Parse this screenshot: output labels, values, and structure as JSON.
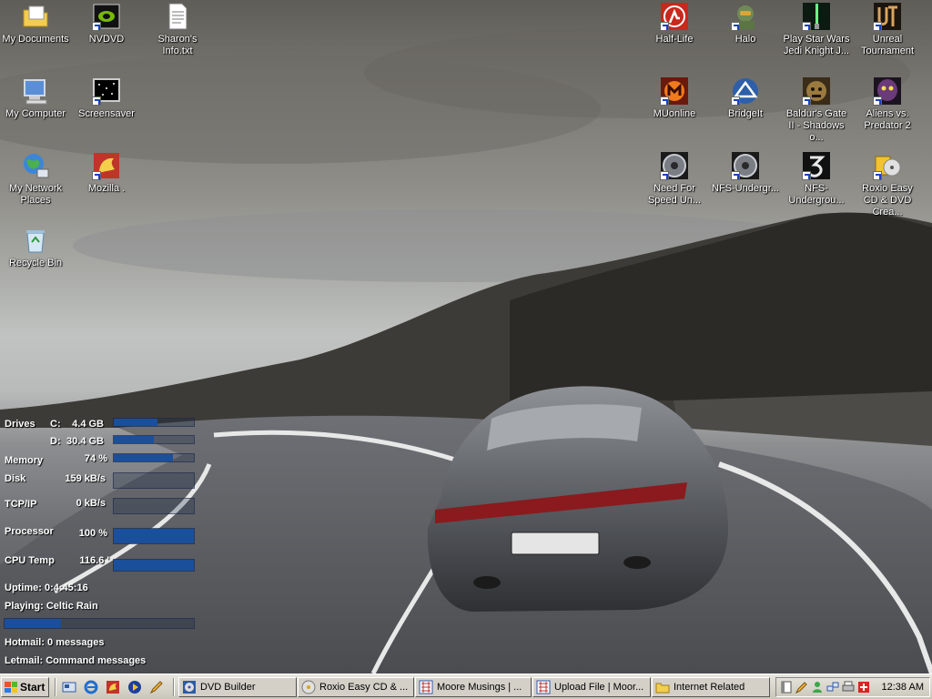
{
  "desktop": {
    "left_icons": [
      {
        "name": "my-documents-icon",
        "label": "My Documents"
      },
      {
        "name": "nvdvd-icon",
        "label": "NVDVD"
      },
      {
        "name": "text-file-icon",
        "label": "Sharon's Info.txt"
      },
      {
        "name": "my-computer-icon",
        "label": "My Computer"
      },
      {
        "name": "screensaver-icon",
        "label": "Screensaver"
      },
      {
        "name": "network-places-icon",
        "label": "My Network Places"
      },
      {
        "name": "mozilla-icon",
        "label": "Mozilla ."
      },
      {
        "name": "recycle-bin-icon",
        "label": "Recycle Bin"
      }
    ],
    "right_icons": [
      {
        "name": "half-life-icon",
        "label": "Half-Life"
      },
      {
        "name": "halo-icon",
        "label": "Halo"
      },
      {
        "name": "jedi-knight-icon",
        "label": "Play Star Wars Jedi Knight J..."
      },
      {
        "name": "unreal-tournament-icon",
        "label": "Unreal Tournament"
      },
      {
        "name": "muonline-icon",
        "label": "MUonline"
      },
      {
        "name": "bridgeit-icon",
        "label": "BridgeIt"
      },
      {
        "name": "baldurs-gate-icon",
        "label": "Baldur's Gate II - Shadows o..."
      },
      {
        "name": "aliens-vs-predator-icon",
        "label": "Aliens vs. Predator 2"
      },
      {
        "name": "need-for-speed-icon",
        "label": "Need For Speed Un..."
      },
      {
        "name": "nfs-underground-icon",
        "label": "NFS-Undergr..."
      },
      {
        "name": "nfs-underground-2-icon",
        "label": "NFS-Undergrou..."
      },
      {
        "name": "roxio-icon",
        "label": "Roxio Easy CD & DVD Crea..."
      }
    ]
  },
  "monitor": {
    "drives_label": "Drives",
    "drive_c_label": "C:",
    "drive_c_value": "4.4 GB",
    "drive_c_fill": 0.55,
    "drive_d_label": "D:",
    "drive_d_value": "30.4 GB",
    "drive_d_fill": 0.5,
    "memory_label": "Memory",
    "memory_value": "74 %",
    "memory_fill": 0.74,
    "disk_label": "Disk",
    "disk_value": "159 kB/s",
    "disk_fill": 0.0,
    "tcpip_label": "TCP/IP",
    "tcpip_value": "0 kB/s",
    "tcpip_fill": 0.0,
    "processor_label": "Processor",
    "processor_value": "100 %",
    "processor_fill": 1.0,
    "cputemp_label": "CPU Temp",
    "cputemp_value": "116.6 '",
    "cputemp_fill": 1.0,
    "uptime": "Uptime: 0:4:45:16",
    "playing": "Playing: Celtic Rain",
    "playing_fill": 0.3,
    "hotmail": "Hotmail: 0 messages",
    "letmail": "Letmail: Command messages"
  },
  "taskbar": {
    "start_label": "Start",
    "tasks": [
      {
        "label": "DVD Builder"
      },
      {
        "label": "Roxio Easy CD & ..."
      },
      {
        "label": "Moore Musings | ..."
      },
      {
        "label": "Upload File | Moor..."
      },
      {
        "label": "Internet Related"
      }
    ],
    "clock": "12:38 AM"
  },
  "colors": {
    "bar_fill": "#1a4f9b",
    "taskbar": "#d4d0c8"
  }
}
